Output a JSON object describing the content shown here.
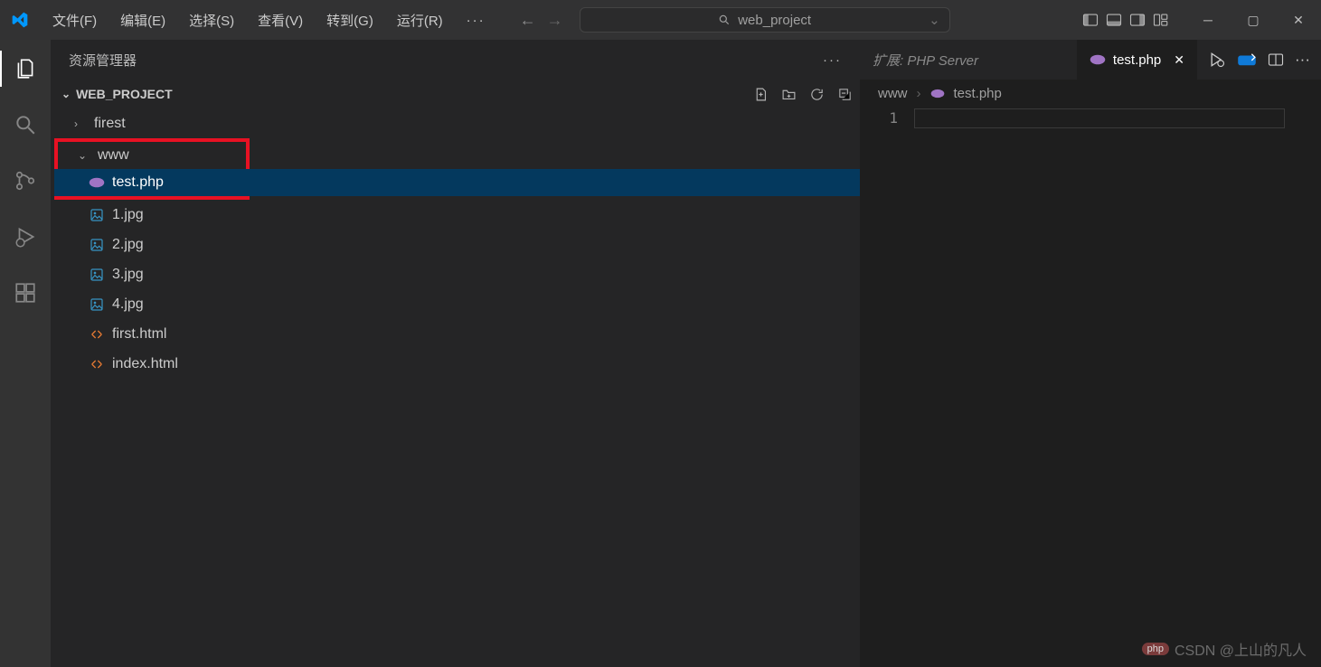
{
  "menu": {
    "items": [
      "文件(F)",
      "编辑(E)",
      "选择(S)",
      "查看(V)",
      "转到(G)",
      "运行(R)"
    ],
    "overflow": "···"
  },
  "search": {
    "text": "web_project"
  },
  "sidebar": {
    "title": "资源管理器",
    "project": "WEB_PROJECT",
    "tree": {
      "firest": "firest",
      "www": "www",
      "test": "test.php",
      "f1": "1.jpg",
      "f2": "2.jpg",
      "f3": "3.jpg",
      "f4": "4.jpg",
      "first": "first.html",
      "index": "index.html"
    }
  },
  "tabs": {
    "other": "扩展: PHP Server",
    "active": "test.php"
  },
  "breadcrumb": {
    "p1": "www",
    "p2": "test.php"
  },
  "code": {
    "line1": "1"
  },
  "watermark": {
    "text": "CSDN @上山的凡人",
    "badge": "php"
  }
}
